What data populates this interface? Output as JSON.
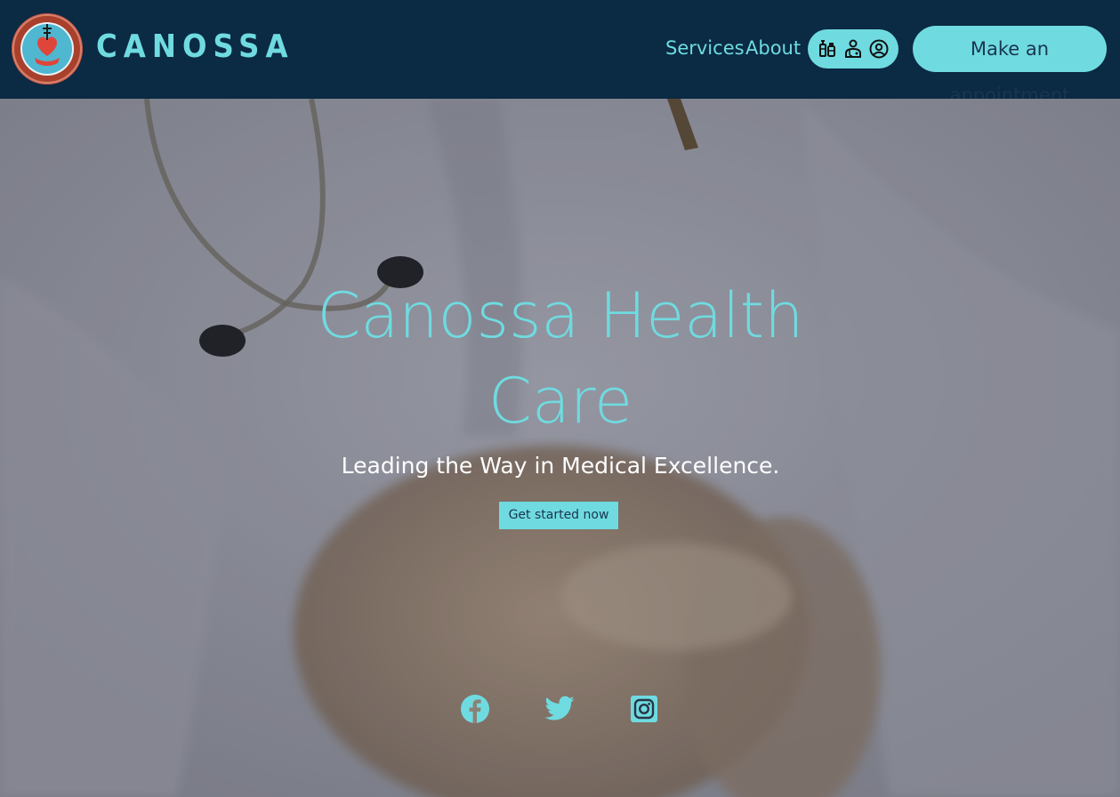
{
  "header": {
    "brand": "CANOSSA",
    "nav": [
      {
        "label": "Services"
      },
      {
        "label": "About"
      }
    ],
    "icons": [
      "vaccine-icon",
      "doctor-icon",
      "user-circle-icon"
    ],
    "appointment_label": "Make an appointment"
  },
  "hero": {
    "title_line1": "Canossa Health",
    "title_line2": "Care",
    "subtitle": "Leading the Way in Medical Excellence.",
    "cta_label": "Get started now"
  },
  "social": [
    "facebook-icon",
    "twitter-icon",
    "instagram-icon"
  ],
  "colors": {
    "navbar": "#0b2a43",
    "accent": "#6fdbe0",
    "logo_red": "#a23a2a"
  }
}
